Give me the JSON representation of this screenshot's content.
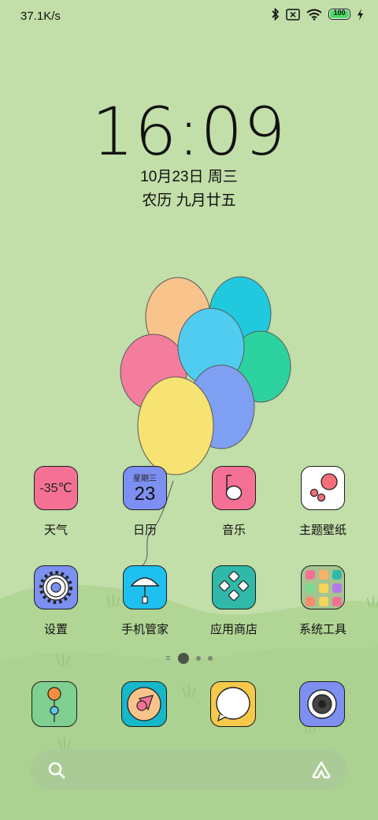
{
  "status_bar": {
    "net_speed": "37.1K/s",
    "battery_level": "100",
    "battery_fraction": 1.0,
    "icons": [
      "bluetooth-icon",
      "no-sim-icon",
      "wifi-icon",
      "battery-icon",
      "charging-icon"
    ]
  },
  "lockscreen_widget": {
    "time": "16:09",
    "date": "10月23日 周三",
    "lunar_date": "农历 九月廿五"
  },
  "weather_tile": {
    "temp": "-35℃"
  },
  "calendar_tile": {
    "weekday": "星期三",
    "day": "23"
  },
  "apps_row1": [
    {
      "label": "天气",
      "icon": "weather-icon"
    },
    {
      "label": "日历",
      "icon": "calendar-icon"
    },
    {
      "label": "音乐",
      "icon": "music-icon"
    },
    {
      "label": "主题壁纸",
      "icon": "themes-icon"
    }
  ],
  "apps_row2": [
    {
      "label": "设置",
      "icon": "settings-gear-icon"
    },
    {
      "label": "手机管家",
      "icon": "security-umbrella-icon"
    },
    {
      "label": "应用商店",
      "icon": "app-store-icon"
    },
    {
      "label": "系统工具",
      "icon": "tools-folder-icon"
    }
  ],
  "page_indicator": {
    "pages": 3,
    "active": 0
  },
  "dock": [
    {
      "icon": "phone-balloon-icon"
    },
    {
      "icon": "browser-compass-icon"
    },
    {
      "icon": "messages-bubble-icon"
    },
    {
      "icon": "camera-icon"
    }
  ],
  "search_bar": {
    "left_icon": "search-icon",
    "right_icon": "assistant-icon"
  },
  "colors": {
    "background": "#c2dea9",
    "weather": "#f47195",
    "calendar": "#7d8ff0",
    "music": "#f47195",
    "settings": "#7b90f0",
    "security": "#1ec0ef",
    "store": "#30b9a8"
  }
}
